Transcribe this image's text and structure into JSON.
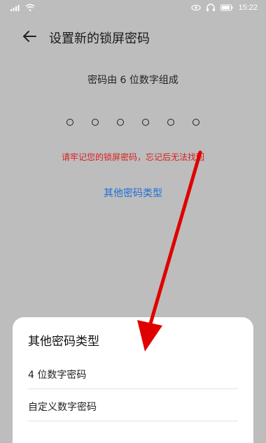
{
  "status_bar": {
    "time": "15:22"
  },
  "header": {
    "title": "设置新的锁屏密码"
  },
  "main": {
    "hint": "密码由 6 位数字组成",
    "pin_length": 6,
    "warning": "请牢记您的锁屏密码，忘记后无法找回",
    "other_types_link": "其他密码类型"
  },
  "sheet": {
    "title": "其他密码类型",
    "items": [
      {
        "label": "4 位数字密码"
      },
      {
        "label": "自定义数字密码"
      }
    ]
  },
  "colors": {
    "accent": "#1e6fd6",
    "warning": "#d81e1e",
    "annotation_arrow": "#e00000"
  }
}
